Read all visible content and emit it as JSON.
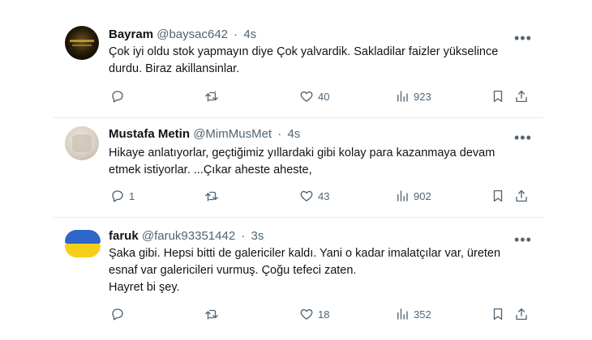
{
  "tweets": [
    {
      "name": "Bayram",
      "handle": "@baysac642",
      "separator": "·",
      "time": "4s",
      "more": "•••",
      "lines": [
        "Çok iyi oldu stok yapmayın diye Çok yalvardik. Sakladilar faizler yükselince",
        "durdu. Biraz akillansinlar."
      ],
      "replies": "",
      "retweets": "",
      "likes": "40",
      "views": "923"
    },
    {
      "name": "Mustafa Metin",
      "handle": "@MimMusMet",
      "separator": "·",
      "time": "4s",
      "more": "•••",
      "lines": [
        "Hikaye anlatıyorlar, geçtiğimiz yıllardaki gibi kolay para kazanmaya devam",
        "etmek istiyorlar. ...Çıkar aheste aheste,"
      ],
      "replies": "1",
      "retweets": "",
      "likes": "43",
      "views": "902"
    },
    {
      "name": "faruk",
      "handle": "@faruk93351442",
      "separator": "·",
      "time": "3s",
      "more": "•••",
      "lines": [
        "Şaka gibi. Hepsi bitti de galericiler kaldı. Yani o kadar imalatçılar var, üreten",
        "esnaf var galericileri vurmuş.  Çoğu tefeci zaten.",
        "Hayret bi şey."
      ],
      "replies": "",
      "retweets": "",
      "likes": "18",
      "views": "352"
    }
  ],
  "icons": {
    "reply": "reply-icon",
    "retweet": "retweet-icon",
    "like": "heart-icon",
    "views": "views-icon",
    "bookmark": "bookmark-icon",
    "share": "share-icon"
  },
  "colors": {
    "text": "#0f1419",
    "secondary": "#536471",
    "divider": "#e6ecf0"
  }
}
